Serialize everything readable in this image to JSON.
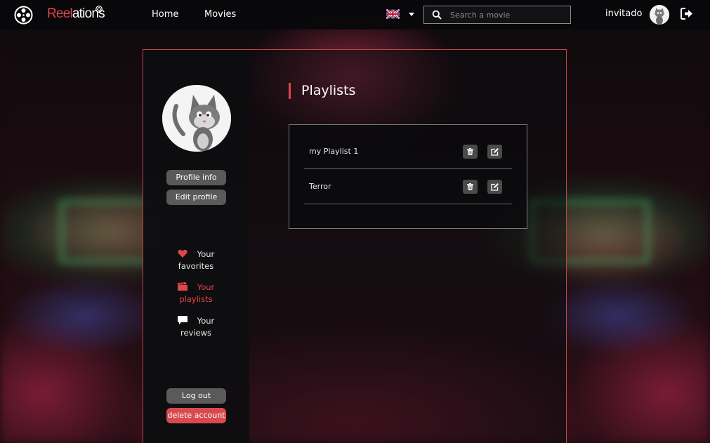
{
  "navbar": {
    "brand_part1": "Reel",
    "brand_part2": "ations",
    "home_label": "Home",
    "movies_label": "Movies",
    "language_flag": "uk-flag-icon",
    "search_placeholder": "Search a movie",
    "username": "invitado"
  },
  "sidebar": {
    "profile_info_label": "Profile info",
    "edit_profile_label": "Edit profile",
    "menu": [
      {
        "label": "Your favorites",
        "icon": "heart-icon"
      },
      {
        "label": "Your playlists",
        "icon": "clapperboard-icon"
      },
      {
        "label": "Your reviews",
        "icon": "comment-icon"
      }
    ],
    "logout_label": "Log out",
    "delete_label": "delete account"
  },
  "main": {
    "title": "Playlists",
    "playlists": [
      {
        "name": "my Playlist 1"
      },
      {
        "name": "Terror"
      }
    ]
  },
  "colors": {
    "accent": "#e0454a",
    "active_menu": "#e0454a",
    "button_grey": "#5a5a5a"
  }
}
